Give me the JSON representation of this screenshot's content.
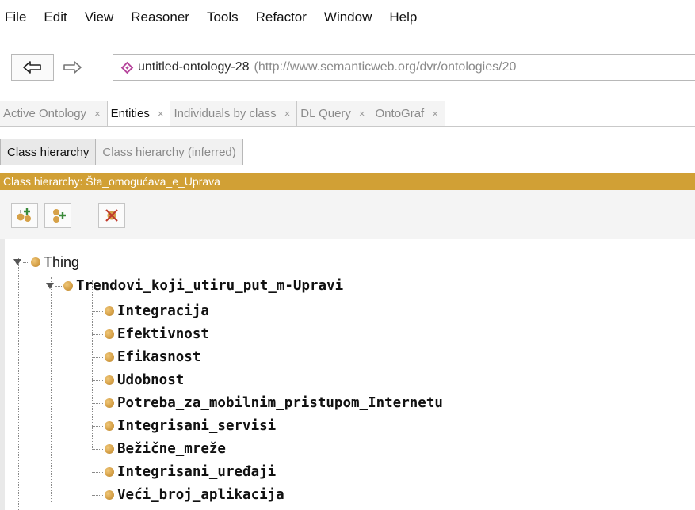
{
  "menubar": {
    "items": [
      "File",
      "Edit",
      "View",
      "Reasoner",
      "Tools",
      "Refactor",
      "Window",
      "Help"
    ]
  },
  "navigation": {
    "back_icon": "left-arrow",
    "forward_icon": "right-arrow",
    "ontology_name": "untitled-ontology-28",
    "ontology_iri": "(http://www.semanticweb.org/dvr/ontologies/20"
  },
  "tabs": [
    {
      "label": "Active Ontology",
      "close": "×",
      "active": false
    },
    {
      "label": "Entities",
      "close": "×",
      "active": true
    },
    {
      "label": "Individuals by class",
      "close": "×",
      "active": false
    },
    {
      "label": "DL Query",
      "close": "×",
      "active": false
    },
    {
      "label": "OntoGraf",
      "close": "×",
      "active": false
    }
  ],
  "subtabs": [
    {
      "label": "Class hierarchy",
      "active": true
    },
    {
      "label": "Class hierarchy (inferred)",
      "active": false
    }
  ],
  "view_header": {
    "title": "Class hierarchy: Šta_omogućava_e_Uprava",
    "color": "#d1a035"
  },
  "toolbar": {
    "buttons": [
      "add-subclass-icon",
      "add-sibling-class-icon",
      "delete-class-icon"
    ]
  },
  "tree": {
    "root": "Thing",
    "level1": "Trendovi_koji_utiru_put_m-Upravi",
    "children": [
      "Integracija",
      "Efektivnost",
      "Efikasnost",
      "Udobnost",
      "Potreba_za_mobilnim_pristupom_Internetu",
      "Integrisani_servisi",
      "Bežične_mreže",
      "Integrisani_uređaji",
      "Veći_broj_aplikacija"
    ],
    "class_color": "#d6a148"
  }
}
